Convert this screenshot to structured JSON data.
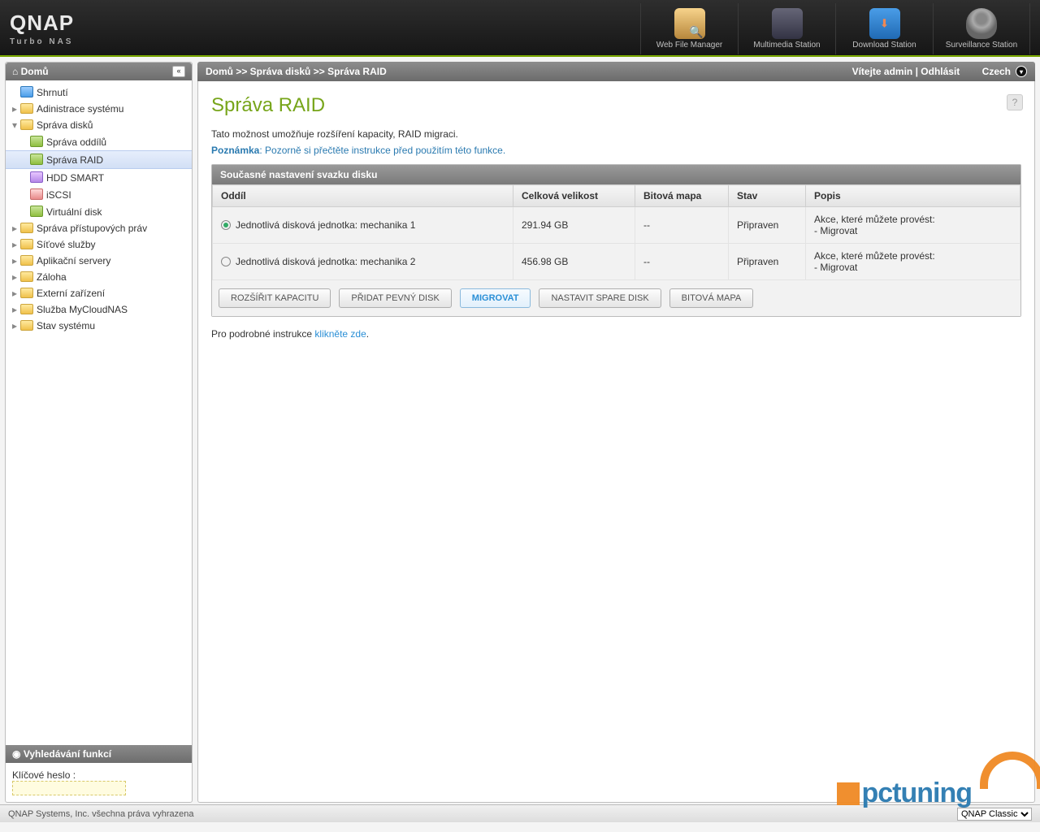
{
  "logo": {
    "brand": "QNAP",
    "sub": "Turbo NAS"
  },
  "apps": [
    {
      "label": "Web File Manager"
    },
    {
      "label": "Multimedia Station"
    },
    {
      "label": "Download Station"
    },
    {
      "label": "Surveillance Station"
    }
  ],
  "sidebar": {
    "title": "Domů",
    "items": {
      "overview": "Shrnutí",
      "admin": "Adinistrace systému",
      "disks": "Správa disků",
      "disks_children": {
        "volumes": "Správa oddílů",
        "raid": "Správa RAID",
        "smart": "HDD SMART",
        "iscsi": "iSCSI",
        "vdisk": "Virtuální disk"
      },
      "access": "Správa přístupových práv",
      "network": "Síťové služby",
      "appserv": "Aplikační servery",
      "backup": "Záloha",
      "ext": "Externí zařízení",
      "cloud": "Služba MyCloudNAS",
      "status": "Stav systému"
    },
    "search_title": "Vyhledávání funkcí",
    "search_label": "Klíčové heslo :"
  },
  "breadcrumb": {
    "path": "Domů >> Správa disků >> Správa RAID",
    "welcome": "Vítejte admin",
    "logout": "Odhlásit",
    "lang": "Czech"
  },
  "page": {
    "title": "Správa RAID",
    "intro": "Tato možnost umožňuje rozšíření kapacity, RAID migraci.",
    "note_label": "Poznámka",
    "note_text": ": Pozorně si přečtěte instrukce před použitím této funkce.",
    "panel_title": "Současné nastavení svazku disku",
    "cols": {
      "vol": "Oddíl",
      "size": "Celková velikost",
      "bitmap": "Bitová mapa",
      "state": "Stav",
      "desc": "Popis"
    },
    "rows": [
      {
        "vol": "Jednotlivá disková jednotka: mechanika 1",
        "size": "291.94 GB",
        "bitmap": "--",
        "state": "Připraven",
        "desc1": "Akce, které můžete provést:",
        "desc2": "  - Migrovat",
        "sel": true
      },
      {
        "vol": "Jednotlivá disková jednotka: mechanika 2",
        "size": "456.98 GB",
        "bitmap": "--",
        "state": "Připraven",
        "desc1": "Akce, které můžete provést:",
        "desc2": "  - Migrovat",
        "sel": false
      }
    ],
    "buttons": {
      "expand": "ROZŠÍŘIT KAPACITU",
      "add": "PŘIDAT PEVNÝ DISK",
      "migrate": "MIGROVAT",
      "spare": "NASTAVIT SPARE DISK",
      "bitmap": "BITOVÁ MAPA"
    },
    "detail_pre": "Pro podrobné instrukce ",
    "detail_link": "klikněte zde"
  },
  "footer": {
    "copyright": "QNAP Systems, Inc. všechna práva vyhrazena",
    "theme": "QNAP Classic"
  },
  "watermark": "pctuning"
}
